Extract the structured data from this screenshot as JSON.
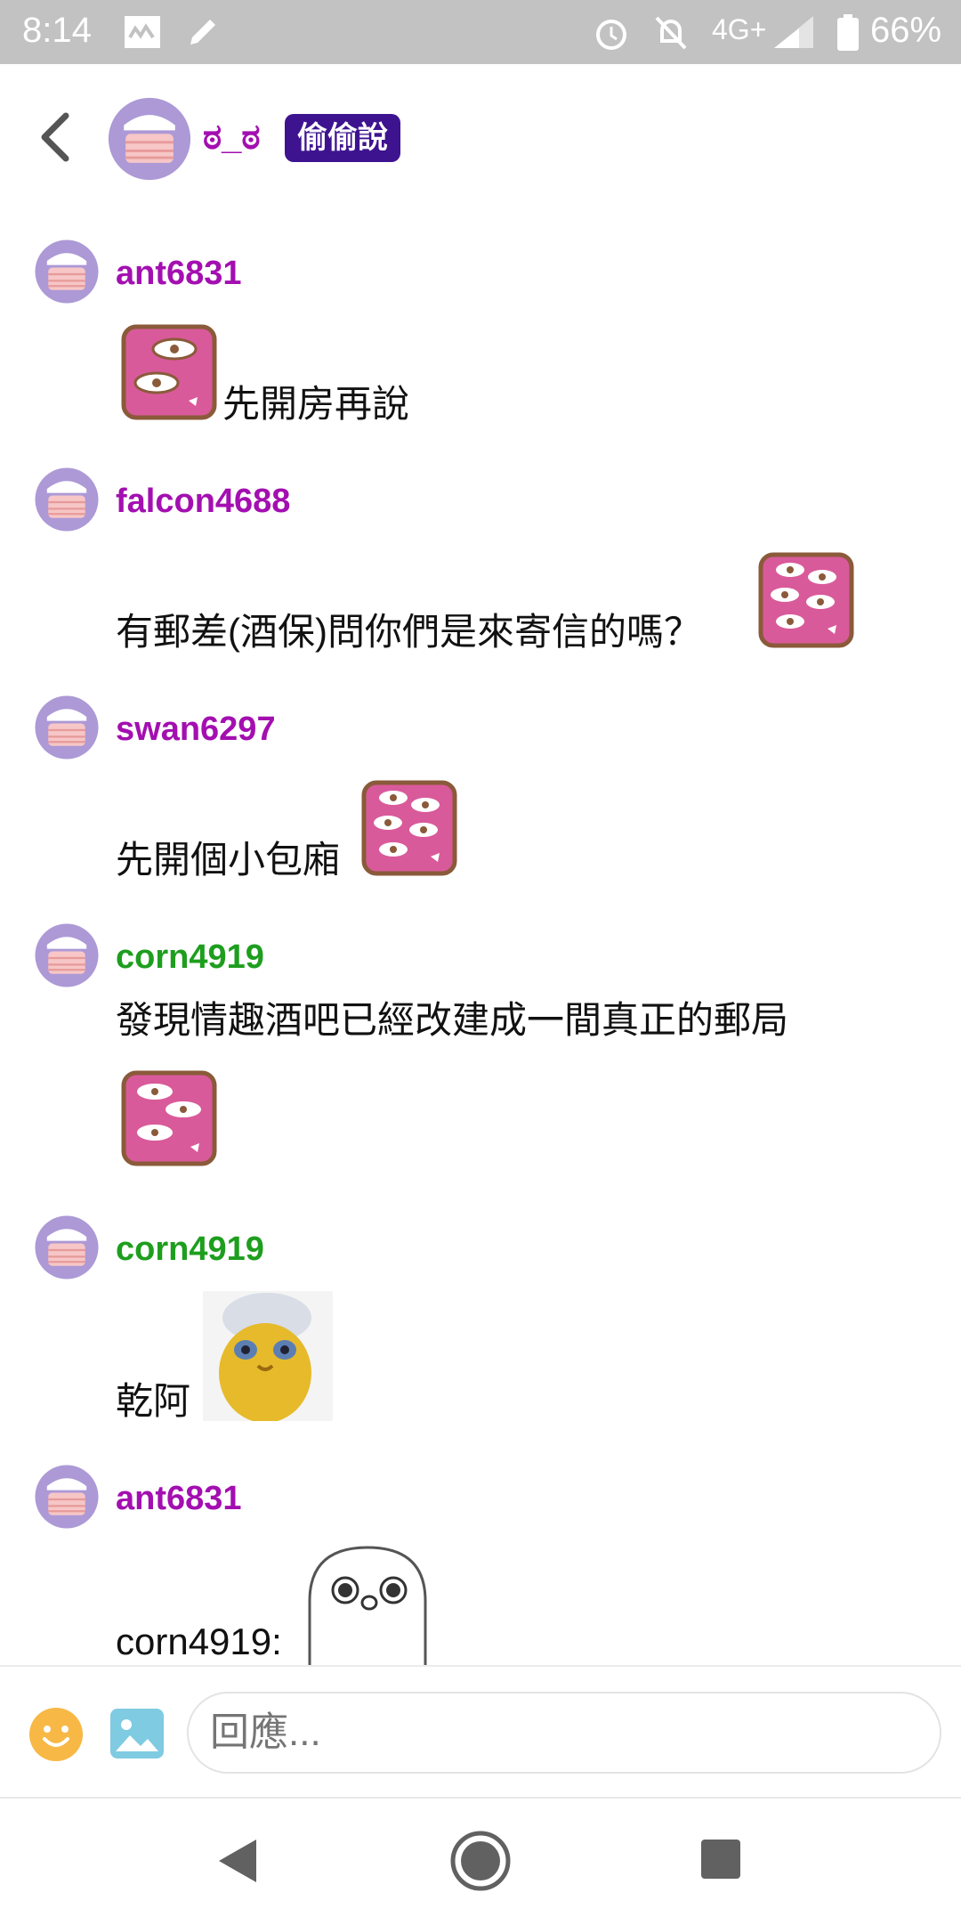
{
  "status_bar": {
    "time": "8:14",
    "network": "4G+",
    "battery": "66%"
  },
  "header": {
    "name": "ಠ_ಠ",
    "badge": "偷偷說"
  },
  "colors": {
    "purple_name": "#a30fb0",
    "green_name": "#1e9e1e",
    "badge_bg": "#3d1390"
  },
  "messages": [
    {
      "user": "ant6831",
      "text": "先開房再說"
    },
    {
      "user": "falcon4688",
      "text": "有郵差(酒保)問你們是來寄信的嗎？"
    },
    {
      "user": "swan6297",
      "text": "先開個小包廂"
    },
    {
      "user": "corn4919",
      "text": "發現情趣酒吧已經改建成一間真正的郵局"
    },
    {
      "user": "corn4919",
      "text": "乾阿"
    },
    {
      "user": "ant6831",
      "text": "corn4919:"
    }
  ],
  "composer": {
    "placeholder": "回應..."
  }
}
